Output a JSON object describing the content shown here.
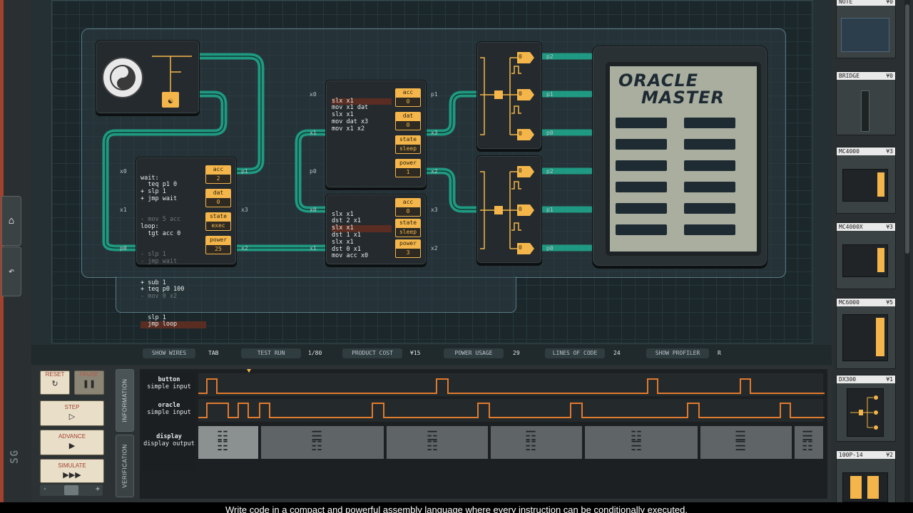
{
  "nav": {
    "home_icon": "home-icon",
    "undo_icon": "undo-icon",
    "brand": "SG"
  },
  "chips": {
    "mc1": {
      "code": [
        "wait:",
        "  teq p1 0",
        "+ slp 1",
        "+ jmp wait",
        "- mov 5 acc",
        "loop:",
        "  tgt acc 0",
        "- slp 1",
        "- jmp wait",
        "+ sub 1",
        "+ teq p0 100",
        "- mov 0 x2",
        "  slp 1",
        "  jmp loop"
      ],
      "regs": [
        {
          "n": "acc",
          "v": "2"
        },
        {
          "n": "dat",
          "v": "0"
        },
        {
          "n": "state",
          "v": "exec"
        },
        {
          "n": "power",
          "v": "25"
        }
      ],
      "pins_left": [
        "x0",
        "x1",
        "p0"
      ],
      "pins_right": [
        "p1",
        "x3",
        "x2"
      ]
    },
    "mc2": {
      "code": [
        "slx x1",
        "mov x1 dat",
        "slx x1",
        "mov dat x3",
        "mov x1 x2"
      ],
      "regs": [
        {
          "n": "acc",
          "v": "0"
        },
        {
          "n": "dat",
          "v": "0"
        },
        {
          "n": "state",
          "v": "sleep"
        },
        {
          "n": "power",
          "v": "1"
        }
      ],
      "pins_left": [
        "x0",
        "x1",
        "p0"
      ],
      "pins_right": [
        "p1",
        "x3",
        "x2"
      ]
    },
    "mc3": {
      "code": [
        "slx x1",
        "dst 2 x1",
        "slx x1",
        "dst 1 x1",
        "slx x1",
        "dst 0 x1",
        "mov acc x0"
      ],
      "regs": [
        {
          "n": "acc",
          "v": "0"
        },
        {
          "n": "state",
          "v": "sleep"
        },
        {
          "n": "power",
          "v": "3"
        }
      ],
      "pins_left": [
        "x0",
        "x1"
      ],
      "pins_right": [
        "x3",
        "x2"
      ]
    },
    "dx_top": {
      "pins": [
        "p2",
        "p1",
        "p0"
      ],
      "vals": [
        "0",
        "0",
        "0"
      ]
    },
    "dx_bot": {
      "pins": [
        "p2",
        "p1",
        "p0"
      ],
      "vals": [
        "0",
        "0",
        "0"
      ]
    }
  },
  "oracle": {
    "line1": "ORACLE",
    "line2": "MASTER"
  },
  "status": {
    "show_wires": "SHOW WIRES",
    "show_wires_key": "TAB",
    "test_run": "TEST RUN",
    "test_run_val": "1/80",
    "product_cost": "PRODUCT COST",
    "product_cost_val": "¥15",
    "power_usage": "POWER USAGE",
    "power_usage_val": "29",
    "lines_of_code": "LINES OF CODE",
    "lines_of_code_val": "24",
    "show_profiler": "SHOW PROFILER",
    "show_profiler_key": "R"
  },
  "controls": {
    "reset": "RESET",
    "pause": "PAUSE",
    "step": "STEP",
    "advance": "ADVANCE",
    "simulate": "SIMULATE",
    "minus": "-",
    "plus": "+"
  },
  "tabs": {
    "information": "INFORMATION",
    "verification": "VERIFICATION"
  },
  "signals": [
    {
      "name": "button",
      "type": "simple input"
    },
    {
      "name": "oracle",
      "type": "simple input"
    },
    {
      "name": "display",
      "type": "display output"
    }
  ],
  "parts": [
    {
      "name": "NOTE",
      "cost": "¥0"
    },
    {
      "name": "BRIDGE",
      "cost": "¥0"
    },
    {
      "name": "MC4000",
      "cost": "¥3"
    },
    {
      "name": "MC4000X",
      "cost": "¥3"
    },
    {
      "name": "MC6000",
      "cost": "¥5"
    },
    {
      "name": "DX300",
      "cost": "¥1"
    },
    {
      "name": "100P-14",
      "cost": "¥2"
    }
  ],
  "caption": "Write code in a compact and powerful assembly language where every instruction can be conditionally executed.",
  "colors": {
    "wire": "#1fa58a",
    "accent": "#f4b64a",
    "trace": "#e07a2e"
  }
}
